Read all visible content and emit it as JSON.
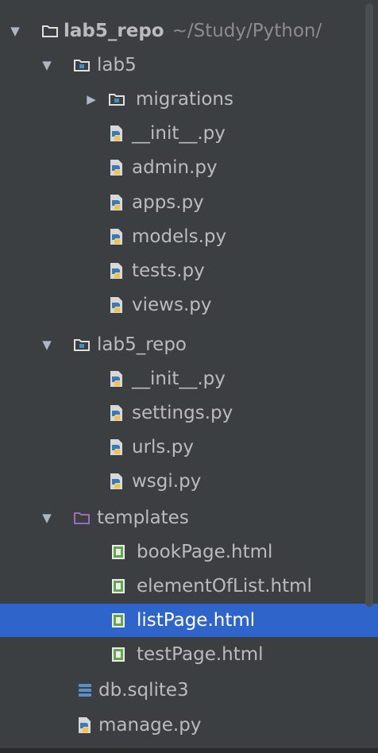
{
  "project_tree": {
    "root": {
      "name": "lab5_repo",
      "path": "~/Study/Python/"
    },
    "lab5": {
      "name": "lab5",
      "migrations": "migrations",
      "files": [
        "__init__.py",
        "admin.py",
        "apps.py",
        "models.py",
        "tests.py",
        "views.py"
      ]
    },
    "lab5_repo": {
      "name": "lab5_repo",
      "files": [
        "__init__.py",
        "settings.py",
        "urls.py",
        "wsgi.py"
      ]
    },
    "templates": {
      "name": "templates",
      "files": [
        "bookPage.html",
        "elementOfList.html",
        "listPage.html",
        "testPage.html"
      ],
      "selected": "listPage.html"
    },
    "db": "db.sqlite3",
    "manage": "manage.py"
  },
  "colors": {
    "background": "#3c3f41",
    "selection": "#2f65ca",
    "text": "#bbbbbb",
    "path_text": "#8c8c8c",
    "folder_outline": "#e1dfd8",
    "package_dot": "#3f8fcb",
    "template_folder": "#9c6cbc",
    "python_blue": "#3b78b7",
    "python_yellow": "#f2c54a",
    "html_green": "#62a84b",
    "db_blue": "#5b8fc8"
  },
  "icons": {
    "folder": "folder-icon",
    "package": "package-folder-icon",
    "template_folder": "template-folder-icon",
    "python": "python-file-icon",
    "html": "html-file-icon",
    "database": "database-icon"
  }
}
